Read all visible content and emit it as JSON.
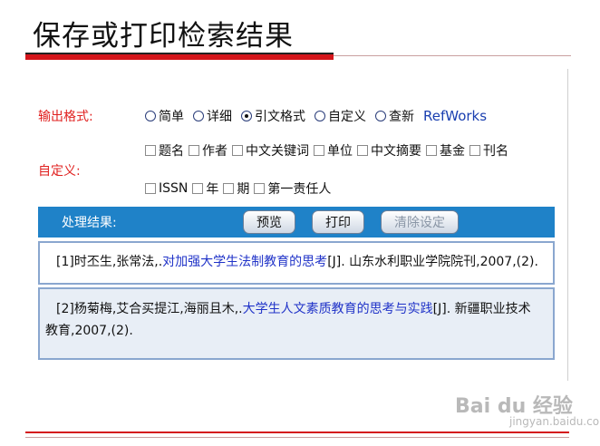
{
  "slide": {
    "title": "保存或打印检索结果"
  },
  "format": {
    "label": "输出格式:",
    "options": [
      {
        "label": "简单",
        "checked": false
      },
      {
        "label": "详细",
        "checked": false
      },
      {
        "label": "引文格式",
        "checked": true
      },
      {
        "label": "自定义",
        "checked": false
      },
      {
        "label": "查新",
        "checked": false
      }
    ],
    "refworks": "RefWorks"
  },
  "custom": {
    "label": "自定义:",
    "fields_row1": [
      "题名",
      "作者",
      "中文关键词",
      "单位",
      "中文摘要",
      "基金",
      "刊名"
    ],
    "fields_row2": [
      "ISSN",
      "年",
      "期",
      "第一责任人"
    ]
  },
  "results": {
    "label": "处理结果:",
    "buttons": {
      "preview": "预览",
      "print": "打印",
      "clear": "清除设定"
    },
    "items": [
      {
        "prefix": "[1]时丕生,张常法,.",
        "title": "对加强大学生法制教育的思考",
        "suffix": "[J]. 山东水利职业学院院刊,2007,(2)."
      },
      {
        "prefix": "[2]杨菊梅,艾合买提江,海丽且木,.",
        "title": "大学生人文素质教育的思考与实践",
        "suffix": "[J]. 新疆职业技术教育,2007,(2)."
      }
    ]
  },
  "watermark": {
    "brand": "Bai du 经验",
    "url": "jingyan.baidu.com"
  }
}
